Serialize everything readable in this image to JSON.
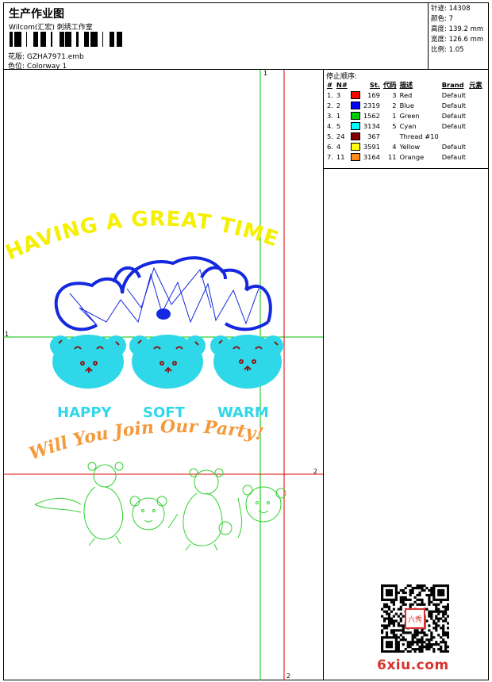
{
  "header": {
    "title": "生产作业图",
    "company": "Wilcom(汇宏) 刺绣工作室",
    "design_label": "花版:",
    "design_value": "GZHA7971.emb",
    "colorway_label": "色位:",
    "colorway_value": "Colorway 1"
  },
  "stats": {
    "stitches_label": "针迹:",
    "stitches_value": "14308",
    "colors_label": "颜色:",
    "colors_value": "7",
    "height_label": "高度:",
    "height_value": "139.2 mm",
    "width_label": "宽度:",
    "width_value": "126.6 mm",
    "scale_label": "比例:",
    "scale_value": "1.05"
  },
  "stop_sequence": {
    "title": "停止顺序:",
    "headers": {
      "index": "#",
      "no": "N#",
      "stitches": "St.",
      "code": "代码",
      "desc": "描述",
      "brand": "Brand",
      "element": "元素"
    },
    "rows": [
      {
        "index": "1.",
        "no": "3",
        "color": "#ff0000",
        "stitches": "169",
        "code": "3",
        "desc": "Red",
        "brand": "Default"
      },
      {
        "index": "2.",
        "no": "2",
        "color": "#0000ff",
        "stitches": "2319",
        "code": "2",
        "desc": "Blue",
        "brand": "Default"
      },
      {
        "index": "3.",
        "no": "1",
        "color": "#00cc00",
        "stitches": "1562",
        "code": "1",
        "desc": "Green",
        "brand": "Default"
      },
      {
        "index": "4.",
        "no": "5",
        "color": "#00ffff",
        "stitches": "3134",
        "code": "5",
        "desc": "Cyan",
        "brand": "Default"
      },
      {
        "index": "5.",
        "no": "24",
        "color": "#800000",
        "stitches": "367",
        "code": "",
        "desc": "Thread #10",
        "brand": ""
      },
      {
        "index": "6.",
        "no": "4",
        "color": "#ffff00",
        "stitches": "3591",
        "code": "4",
        "desc": "Yellow",
        "brand": "Default"
      },
      {
        "index": "7.",
        "no": "11",
        "color": "#ff8c1a",
        "stitches": "3164",
        "code": "11",
        "desc": "Orange",
        "brand": "Default"
      }
    ]
  },
  "design": {
    "top_text": "HAVING A GREAT TIME",
    "words": [
      "HAPPY",
      "SOFT",
      "WARM"
    ],
    "bottom_text": "Will You Join Our Party!",
    "guide_labels": {
      "v1": "1",
      "h1": "1",
      "h2": "2",
      "v2": "2"
    },
    "colors": {
      "yellow": "#f5ef00",
      "blue": "#1428e0",
      "cyan": "#2fd8e8",
      "maroon": "#8b1a1a",
      "orange": "#f59a3a",
      "green": "#2fd22f",
      "guide_green": "#00c000",
      "guide_red": "#e00000"
    }
  },
  "watermark": {
    "site": "6xiu.com",
    "seal_text": "六秀"
  }
}
